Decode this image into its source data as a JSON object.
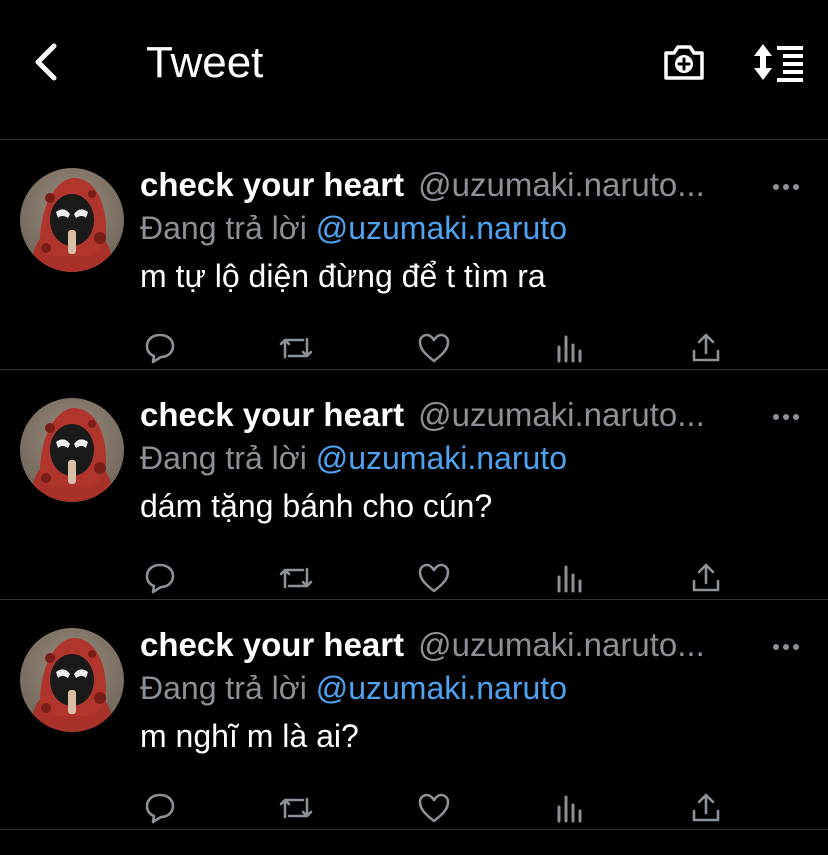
{
  "header": {
    "title": "Tweet",
    "back_icon": "chevron-left-icon",
    "camera_icon": "camera-plus-icon",
    "sort_icon": "sort-list-icon"
  },
  "colors": {
    "background": "#000000",
    "text": "#ffffff",
    "muted": "#8b9196",
    "link": "#4ea2f0",
    "divider": "#2f3336"
  },
  "tweets": [
    {
      "name": "check your heart",
      "handle": "@uzumaki.naruto...",
      "reply_prefix": "Đang trả lời",
      "reply_to": "@uzumaki.naruto",
      "text": "m tự lộ diện đừng để t tìm ra"
    },
    {
      "name": "check your heart",
      "handle": "@uzumaki.naruto...",
      "reply_prefix": "Đang trả lời",
      "reply_to": "@uzumaki.naruto",
      "text": "dám tặng bánh cho cún?"
    },
    {
      "name": "check your heart",
      "handle": "@uzumaki.naruto...",
      "reply_prefix": "Đang trả lời",
      "reply_to": "@uzumaki.naruto",
      "text": "m nghĩ m là ai?"
    }
  ],
  "action_icons": [
    "reply-icon",
    "retweet-icon",
    "like-icon",
    "analytics-icon",
    "share-icon"
  ]
}
